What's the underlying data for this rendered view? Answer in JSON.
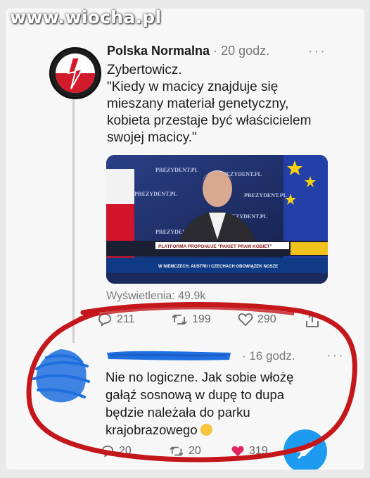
{
  "watermark": "www.wiocha.pl",
  "tweet": {
    "author": "Polska Normalna",
    "meta": "· 20 godz.",
    "more": "···",
    "text": "Zybertowicz.\n\"Kiedy w macicy znajduje się\nmieszany materiał genetyczny,\nkobieta przestaje być właścicielem\nswojej macicy.\"",
    "views": "Wyświetlenia: 49.9k",
    "media": {
      "backdrop_text": [
        "PREZYDENT.PL",
        "PREZYDENT.PL",
        "PREZYDENT.PL",
        "PREZYDENT.PL",
        "PREZYDENT",
        "PREZYDENT.PL"
      ],
      "ticker_headline": "PLATFORMA PROPONUJE \"PAKIET PRAW KOBIET\"",
      "ticker_bottom": "W NIEMCZECH, AUSTRII I CZECHACH OBOWIĄZEK NOSZE"
    },
    "actions": {
      "replies": "211",
      "retweets": "199",
      "likes": "290"
    }
  },
  "reply": {
    "meta": "· 16 godz.",
    "more": "···",
    "text": "Nie no logiczne. Jak sobie włożę\ngałąź sosnową w dupę to dupa\nbędzie należała do parku\nkrajobrazowego",
    "actions": {
      "replies": "20",
      "retweets": "20",
      "likes": "319"
    }
  },
  "colors": {
    "accent": "#1d9bf0",
    "scribble": "#1f6fe0",
    "circle": "#c4171b",
    "like": "#e0245e"
  }
}
